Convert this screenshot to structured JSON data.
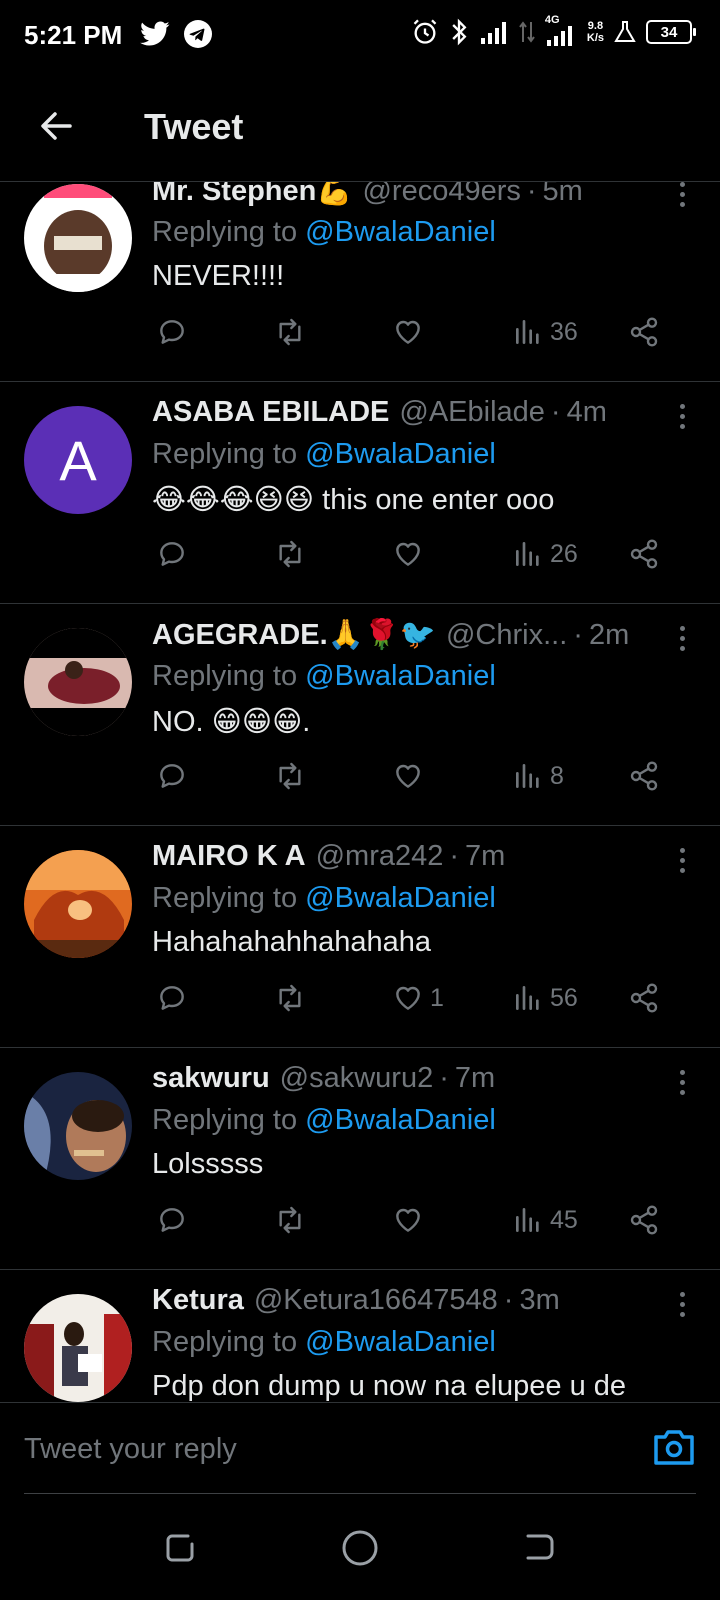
{
  "status_bar": {
    "time": "5:21 PM",
    "network_type": "4G",
    "speed_value": "9.8",
    "speed_unit": "K/s",
    "battery": "34"
  },
  "header": {
    "title": "Tweet"
  },
  "replying_prefix": "Replying to",
  "tweets": [
    {
      "name": "Mr. Stephen💪",
      "handle": "@reco49ers",
      "time": "5m",
      "reply_to": "@BwalaDaniel",
      "text": "NEVER!!!!",
      "replies": "",
      "retweets": "",
      "likes": "",
      "views": "36",
      "avatar_letter": ""
    },
    {
      "name": "ASABA EBILADE",
      "handle": "@AEbilade",
      "time": "4m",
      "reply_to": "@BwalaDaniel",
      "text": "😂😂😂😆😆 this one enter ooo",
      "replies": "",
      "retweets": "",
      "likes": "",
      "views": "26",
      "avatar_letter": "A"
    },
    {
      "name": "AGEGRADE.🙏🌹🐦",
      "handle": "@Chrix...",
      "time": "2m",
      "reply_to": "@BwalaDaniel",
      "text": "NO. 😁😁😁.",
      "replies": "",
      "retweets": "",
      "likes": "",
      "views": "8",
      "avatar_letter": ""
    },
    {
      "name": "MAIRO K A",
      "handle": "@mra242",
      "time": "7m",
      "reply_to": "@BwalaDaniel",
      "text": "Hahahahahhahahaha",
      "replies": "",
      "retweets": "",
      "likes": "1",
      "views": "56",
      "avatar_letter": ""
    },
    {
      "name": "sakwuru",
      "handle": "@sakwuru2",
      "time": "7m",
      "reply_to": "@BwalaDaniel",
      "text": "Lolsssss",
      "replies": "",
      "retweets": "",
      "likes": "",
      "views": "45",
      "avatar_letter": ""
    },
    {
      "name": "Ketura",
      "handle": "@Ketura16647548",
      "time": "3m",
      "reply_to": "@BwalaDaniel",
      "text": "Pdp don dump u now na elupee u de",
      "replies": "",
      "retweets": "",
      "likes": "",
      "views": "",
      "avatar_letter": ""
    }
  ],
  "reply_bar": {
    "placeholder": "Tweet your reply"
  },
  "colors": {
    "background": "#000000",
    "accent": "#1d9bf0",
    "muted": "#71767b",
    "divider": "#2f3336"
  }
}
